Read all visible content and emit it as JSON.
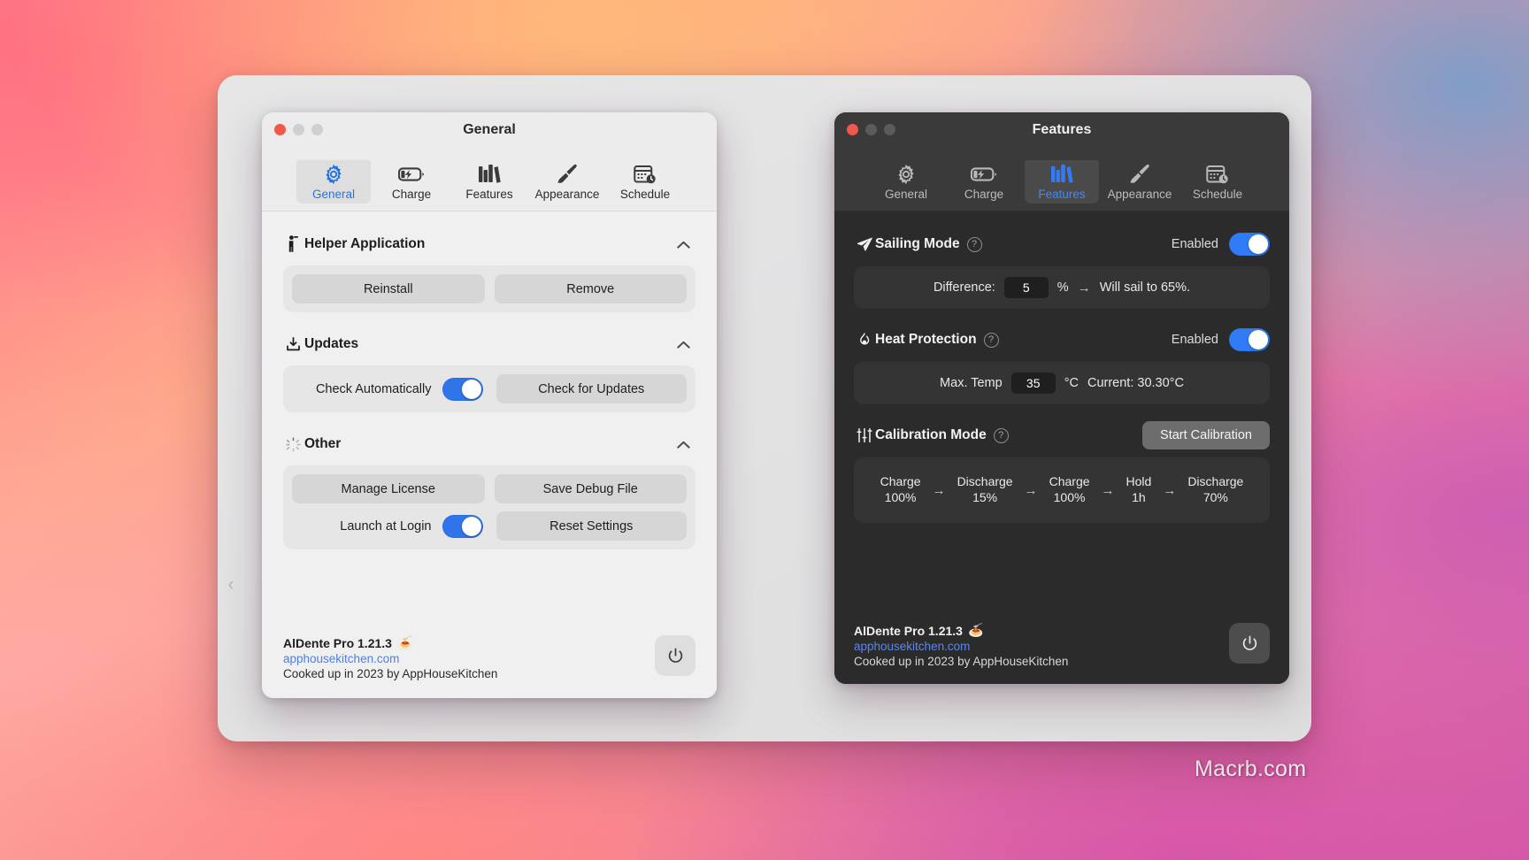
{
  "desktop": {
    "watermark": "Macrb.com"
  },
  "toolbar_tabs": [
    {
      "label": "General",
      "icon": "gear-icon"
    },
    {
      "label": "Charge",
      "icon": "battery-bolt-icon"
    },
    {
      "label": "Features",
      "icon": "books-icon"
    },
    {
      "label": "Appearance",
      "icon": "paintbrush-icon"
    },
    {
      "label": "Schedule",
      "icon": "calendar-clock-icon"
    }
  ],
  "colors": {
    "accent_blue": "#2f74e8",
    "link_blue": "#4f7fe0",
    "close_red": "#f0584b"
  },
  "light_window": {
    "title": "General",
    "selected_tab": "General",
    "sections": [
      {
        "id": "helper",
        "title": "Helper Application",
        "icon": "person-helper-icon",
        "chevron": "chevron-up-icon",
        "buttons": [
          "Reinstall",
          "Remove"
        ]
      },
      {
        "id": "updates",
        "title": "Updates",
        "icon": "download-box-icon",
        "chevron": "chevron-up-icon",
        "toggle_label": "Check Automatically",
        "toggle_on": true,
        "button": "Check for Updates"
      },
      {
        "id": "other",
        "title": "Other",
        "icon": "spinner-icon",
        "chevron": "chevron-up-icon",
        "buttons_row1": [
          "Manage License",
          "Save Debug File"
        ],
        "toggle_label": "Launch at Login",
        "toggle_on": true,
        "button_row2": "Reset Settings"
      }
    ],
    "about": {
      "name": "AlDente Pro 1.21.3",
      "emoji": "🍝",
      "link": "apphousekitchen.com",
      "credit": "Cooked up in 2023 by AppHouseKitchen"
    },
    "power_button": "power-icon"
  },
  "dark_window": {
    "title": "Features",
    "selected_tab": "Features",
    "sailing": {
      "title": "Sailing Mode",
      "icon": "paper-plane-icon",
      "help": "?",
      "enabled_label": "Enabled",
      "enabled": true,
      "difference_label": "Difference:",
      "difference_value": "5",
      "unit": "%",
      "arrow": "→",
      "result": "Will sail to 65%."
    },
    "heat": {
      "title": "Heat Protection",
      "icon": "flame-icon",
      "help": "?",
      "enabled_label": "Enabled",
      "enabled": true,
      "max_temp_label": "Max. Temp",
      "max_temp_value": "35",
      "unit": "°C",
      "current": "Current: 30.30°C"
    },
    "calibration": {
      "title": "Calibration Mode",
      "icon": "sliders-icon",
      "help": "?",
      "button": "Start Calibration",
      "arrow": "→",
      "steps": [
        {
          "line1": "Charge",
          "line2": "100%"
        },
        {
          "line1": "Discharge",
          "line2": "15%"
        },
        {
          "line1": "Charge",
          "line2": "100%"
        },
        {
          "line1": "Hold",
          "line2": "1h"
        },
        {
          "line1": "Discharge",
          "line2": "70%"
        }
      ]
    },
    "about": {
      "name": "AlDente Pro 1.21.3",
      "emoji": "🍝",
      "link": "apphousekitchen.com",
      "credit": "Cooked up in 2023 by AppHouseKitchen"
    },
    "power_button": "power-icon"
  }
}
